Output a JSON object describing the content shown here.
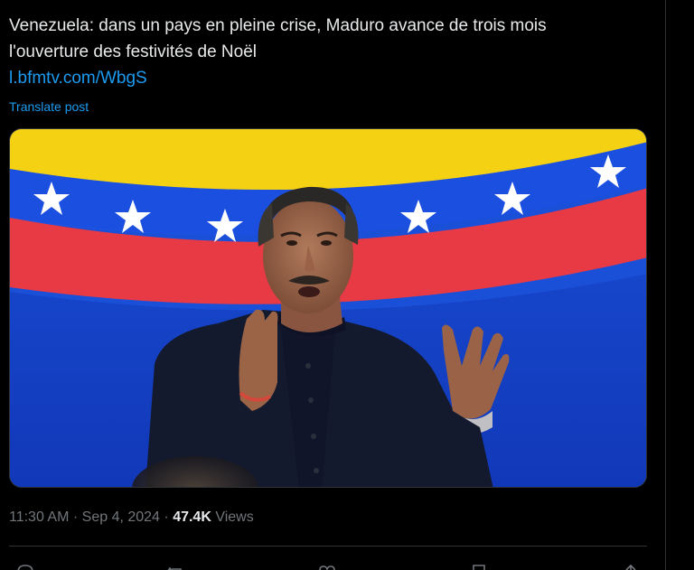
{
  "post": {
    "text_line1": "Venezuela: dans un pays en pleine crise, Maduro avance de trois mois",
    "text_line2": "l'ouverture des festivités de Noël",
    "link": "l.bfmtv.com/WbgS",
    "translate_label": "Translate post"
  },
  "meta": {
    "time": "11:30 AM",
    "date": "Sep 4, 2024",
    "views_count": "47.4K",
    "views_label": "Views",
    "separator": "·"
  },
  "actions": {
    "icons": [
      "reply-icon",
      "repost-icon",
      "like-icon",
      "bookmark-icon",
      "share-icon"
    ]
  },
  "colors": {
    "background": "#000000",
    "text": "#e7e9ea",
    "link": "#1d9bf0",
    "muted": "#71767b",
    "border": "#2f3336"
  }
}
